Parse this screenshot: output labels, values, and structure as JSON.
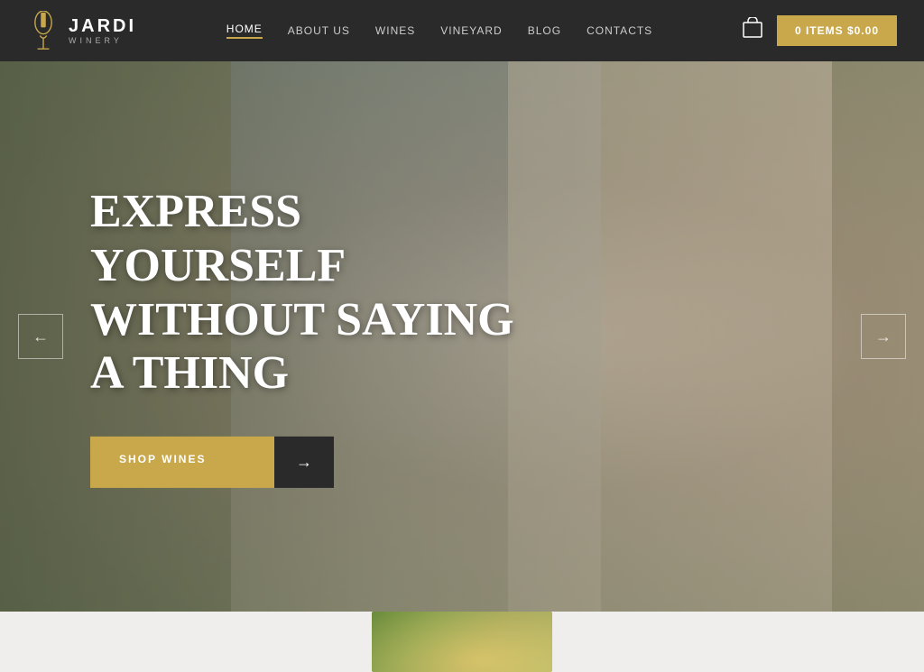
{
  "header": {
    "logo_title": "JARDI",
    "logo_subtitle": "WINERY",
    "nav_items": [
      {
        "label": "HOME",
        "active": true
      },
      {
        "label": "ABOUT US",
        "active": false
      },
      {
        "label": "WINES",
        "active": false
      },
      {
        "label": "VINEYARD",
        "active": false
      },
      {
        "label": "BLOG",
        "active": false
      },
      {
        "label": "CONTACTS",
        "active": false
      }
    ],
    "cart_label": "0 ITEMS $0.00"
  },
  "hero": {
    "headline_line1": "EXPRESS YOURSELF",
    "headline_line2": "WITHOUT SAYING",
    "headline_line3": "A THING",
    "shop_btn_label": "SHOP WINES",
    "arrow_left": "←",
    "arrow_right": "→"
  }
}
